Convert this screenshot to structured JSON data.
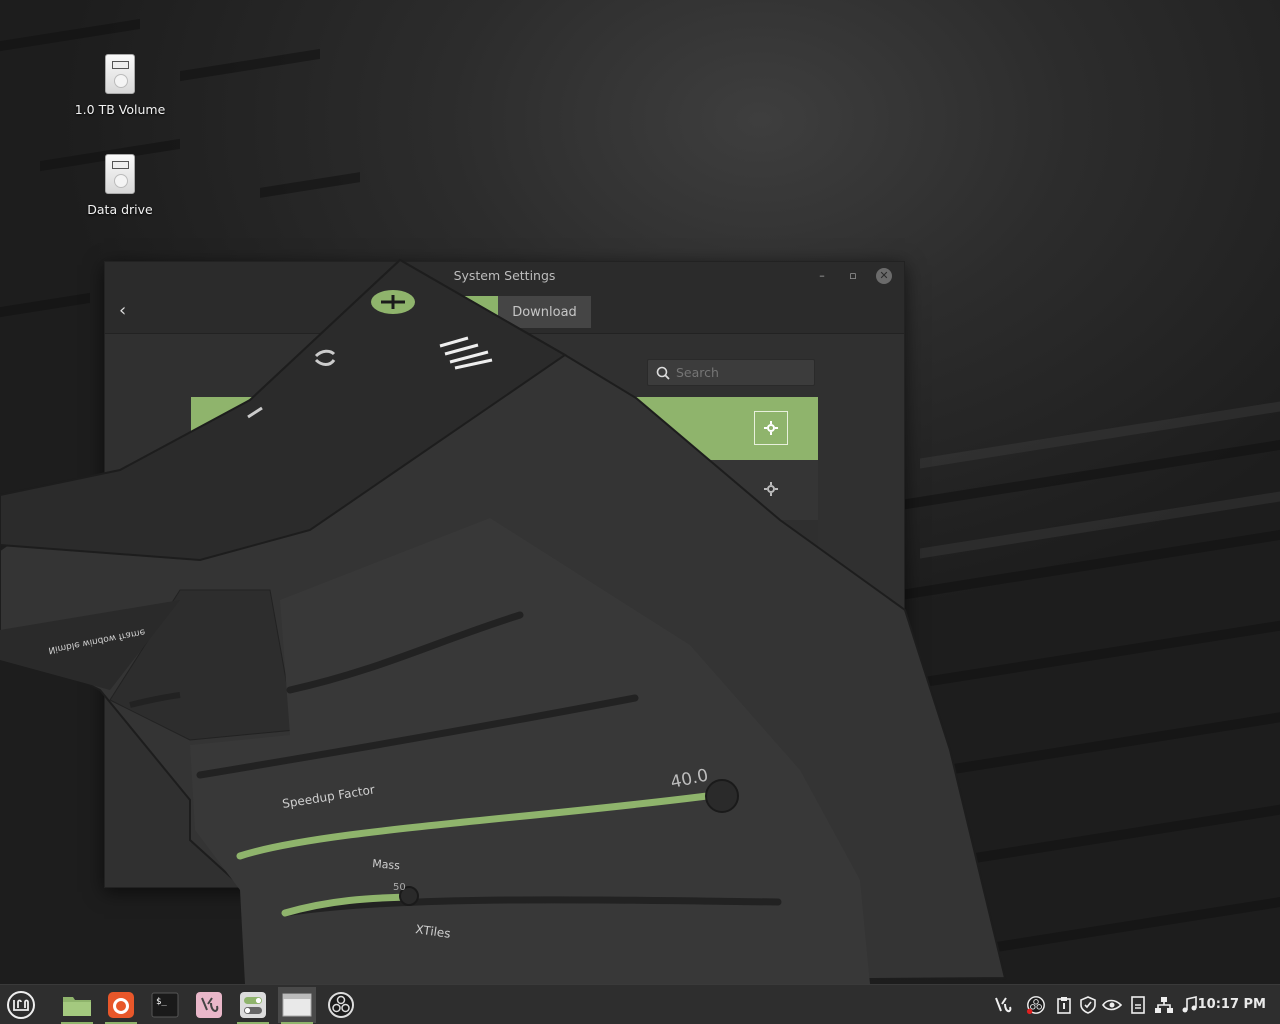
{
  "desktop": {
    "icons": [
      {
        "label": "1.0 TB Volume"
      },
      {
        "label": "Data drive"
      }
    ]
  },
  "window": {
    "title": "System Settings",
    "minimize": "–",
    "maximize": "▫",
    "close": "✕",
    "back": "‹",
    "tabs": [
      {
        "label": "Download"
      }
    ],
    "search": {
      "placeholder": "Search",
      "value": ""
    }
  },
  "overlay": {
    "sliders": [
      {
        "label": "Speedup Factor",
        "value": "40.0"
      },
      {
        "label": "Mass",
        "value": "50"
      },
      {
        "label": "XTiles",
        "value": ""
      }
    ],
    "mirrored_label": "Nimble window frame"
  },
  "taskbar": {
    "apps": [
      "menu",
      "files",
      "firefox",
      "terminal",
      "xed",
      "system-settings",
      "window",
      "obs-studio"
    ],
    "clock": "10:17 PM"
  },
  "colors": {
    "accent": "#8fb46c",
    "panel": "#2e2e2e",
    "window": "#303030"
  }
}
